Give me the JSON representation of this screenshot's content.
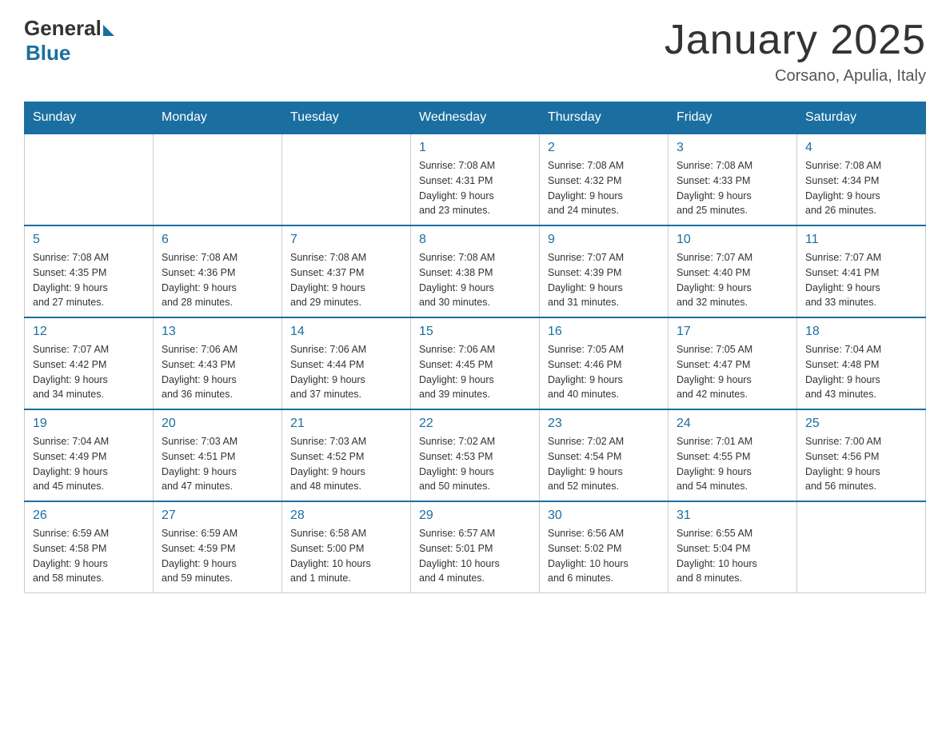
{
  "header": {
    "logo_text_general": "General",
    "logo_text_blue": "Blue",
    "main_title": "January 2025",
    "subtitle": "Corsano, Apulia, Italy"
  },
  "days_of_week": [
    "Sunday",
    "Monday",
    "Tuesday",
    "Wednesday",
    "Thursday",
    "Friday",
    "Saturday"
  ],
  "weeks": [
    {
      "days": [
        {
          "number": "",
          "info": ""
        },
        {
          "number": "",
          "info": ""
        },
        {
          "number": "",
          "info": ""
        },
        {
          "number": "1",
          "info": "Sunrise: 7:08 AM\nSunset: 4:31 PM\nDaylight: 9 hours\nand 23 minutes."
        },
        {
          "number": "2",
          "info": "Sunrise: 7:08 AM\nSunset: 4:32 PM\nDaylight: 9 hours\nand 24 minutes."
        },
        {
          "number": "3",
          "info": "Sunrise: 7:08 AM\nSunset: 4:33 PM\nDaylight: 9 hours\nand 25 minutes."
        },
        {
          "number": "4",
          "info": "Sunrise: 7:08 AM\nSunset: 4:34 PM\nDaylight: 9 hours\nand 26 minutes."
        }
      ]
    },
    {
      "days": [
        {
          "number": "5",
          "info": "Sunrise: 7:08 AM\nSunset: 4:35 PM\nDaylight: 9 hours\nand 27 minutes."
        },
        {
          "number": "6",
          "info": "Sunrise: 7:08 AM\nSunset: 4:36 PM\nDaylight: 9 hours\nand 28 minutes."
        },
        {
          "number": "7",
          "info": "Sunrise: 7:08 AM\nSunset: 4:37 PM\nDaylight: 9 hours\nand 29 minutes."
        },
        {
          "number": "8",
          "info": "Sunrise: 7:08 AM\nSunset: 4:38 PM\nDaylight: 9 hours\nand 30 minutes."
        },
        {
          "number": "9",
          "info": "Sunrise: 7:07 AM\nSunset: 4:39 PM\nDaylight: 9 hours\nand 31 minutes."
        },
        {
          "number": "10",
          "info": "Sunrise: 7:07 AM\nSunset: 4:40 PM\nDaylight: 9 hours\nand 32 minutes."
        },
        {
          "number": "11",
          "info": "Sunrise: 7:07 AM\nSunset: 4:41 PM\nDaylight: 9 hours\nand 33 minutes."
        }
      ]
    },
    {
      "days": [
        {
          "number": "12",
          "info": "Sunrise: 7:07 AM\nSunset: 4:42 PM\nDaylight: 9 hours\nand 34 minutes."
        },
        {
          "number": "13",
          "info": "Sunrise: 7:06 AM\nSunset: 4:43 PM\nDaylight: 9 hours\nand 36 minutes."
        },
        {
          "number": "14",
          "info": "Sunrise: 7:06 AM\nSunset: 4:44 PM\nDaylight: 9 hours\nand 37 minutes."
        },
        {
          "number": "15",
          "info": "Sunrise: 7:06 AM\nSunset: 4:45 PM\nDaylight: 9 hours\nand 39 minutes."
        },
        {
          "number": "16",
          "info": "Sunrise: 7:05 AM\nSunset: 4:46 PM\nDaylight: 9 hours\nand 40 minutes."
        },
        {
          "number": "17",
          "info": "Sunrise: 7:05 AM\nSunset: 4:47 PM\nDaylight: 9 hours\nand 42 minutes."
        },
        {
          "number": "18",
          "info": "Sunrise: 7:04 AM\nSunset: 4:48 PM\nDaylight: 9 hours\nand 43 minutes."
        }
      ]
    },
    {
      "days": [
        {
          "number": "19",
          "info": "Sunrise: 7:04 AM\nSunset: 4:49 PM\nDaylight: 9 hours\nand 45 minutes."
        },
        {
          "number": "20",
          "info": "Sunrise: 7:03 AM\nSunset: 4:51 PM\nDaylight: 9 hours\nand 47 minutes."
        },
        {
          "number": "21",
          "info": "Sunrise: 7:03 AM\nSunset: 4:52 PM\nDaylight: 9 hours\nand 48 minutes."
        },
        {
          "number": "22",
          "info": "Sunrise: 7:02 AM\nSunset: 4:53 PM\nDaylight: 9 hours\nand 50 minutes."
        },
        {
          "number": "23",
          "info": "Sunrise: 7:02 AM\nSunset: 4:54 PM\nDaylight: 9 hours\nand 52 minutes."
        },
        {
          "number": "24",
          "info": "Sunrise: 7:01 AM\nSunset: 4:55 PM\nDaylight: 9 hours\nand 54 minutes."
        },
        {
          "number": "25",
          "info": "Sunrise: 7:00 AM\nSunset: 4:56 PM\nDaylight: 9 hours\nand 56 minutes."
        }
      ]
    },
    {
      "days": [
        {
          "number": "26",
          "info": "Sunrise: 6:59 AM\nSunset: 4:58 PM\nDaylight: 9 hours\nand 58 minutes."
        },
        {
          "number": "27",
          "info": "Sunrise: 6:59 AM\nSunset: 4:59 PM\nDaylight: 9 hours\nand 59 minutes."
        },
        {
          "number": "28",
          "info": "Sunrise: 6:58 AM\nSunset: 5:00 PM\nDaylight: 10 hours\nand 1 minute."
        },
        {
          "number": "29",
          "info": "Sunrise: 6:57 AM\nSunset: 5:01 PM\nDaylight: 10 hours\nand 4 minutes."
        },
        {
          "number": "30",
          "info": "Sunrise: 6:56 AM\nSunset: 5:02 PM\nDaylight: 10 hours\nand 6 minutes."
        },
        {
          "number": "31",
          "info": "Sunrise: 6:55 AM\nSunset: 5:04 PM\nDaylight: 10 hours\nand 8 minutes."
        },
        {
          "number": "",
          "info": ""
        }
      ]
    }
  ]
}
